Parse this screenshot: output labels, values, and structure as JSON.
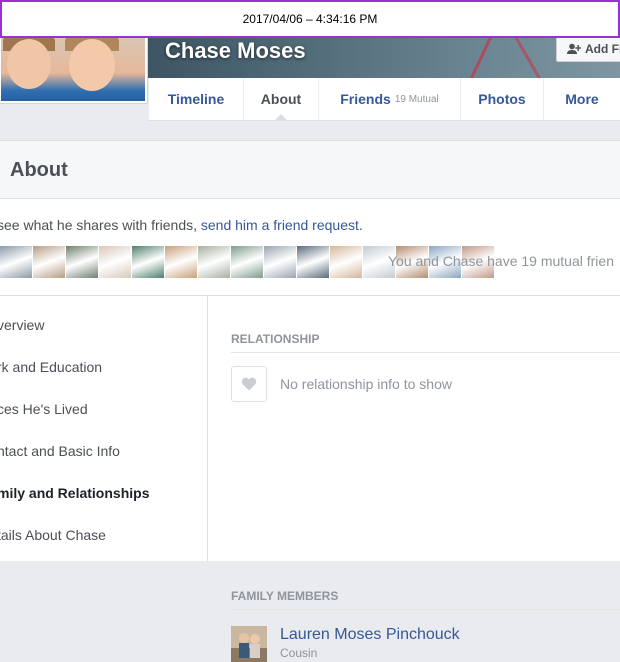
{
  "timestamp_bar": {
    "text": "2017/04/06 –  4:34:16 PM"
  },
  "profile": {
    "name": "Chase Moses"
  },
  "add_friend": {
    "label": "Add Fr"
  },
  "tabs": [
    {
      "label": "Timeline",
      "width": 95
    },
    {
      "label": "About",
      "width": 75
    },
    {
      "label": "Friends",
      "mutual": "19 Mutual",
      "width": 142
    },
    {
      "label": "Photos",
      "width": 83
    },
    {
      "label": "More",
      "width": 77
    }
  ],
  "about": {
    "title": "About",
    "notice_prefix": "see what he shares with friends, ",
    "notice_link": "send him a friend request",
    "notice_suffix": ".",
    "mutual_text": "You and Chase have 19 mutual frien"
  },
  "mutual_thumbs": [
    "#8a9aa8",
    "#b79c86",
    "#6f7f6f",
    "#d9c7b9",
    "#4f7f6a",
    "#c9a07a",
    "#a8b0a0",
    "#7d9b8a",
    "#99a5b2",
    "#5a6a7b",
    "#d5b79a",
    "#c4cbd2",
    "#b58d6e",
    "#8aa6c1",
    "#c29a8a"
  ],
  "side_nav": [
    {
      "label": "verview",
      "active": false
    },
    {
      "label": "rk and Education",
      "active": false
    },
    {
      "label": "ces He's Lived",
      "active": false
    },
    {
      "label": "ntact and Basic Info",
      "active": false
    },
    {
      "label": "mily and Relationships",
      "active": true
    },
    {
      "label": "tails About Chase",
      "active": false
    }
  ],
  "relationship": {
    "heading": "RELATIONSHIP",
    "empty_text": "No relationship info to show"
  },
  "family": {
    "heading": "FAMILY MEMBERS",
    "members": [
      {
        "name": "Lauren Moses Pinchouck",
        "relation": "Cousin"
      }
    ]
  },
  "colors": {
    "link": "#365899",
    "accent_border": "#9b30d9"
  }
}
